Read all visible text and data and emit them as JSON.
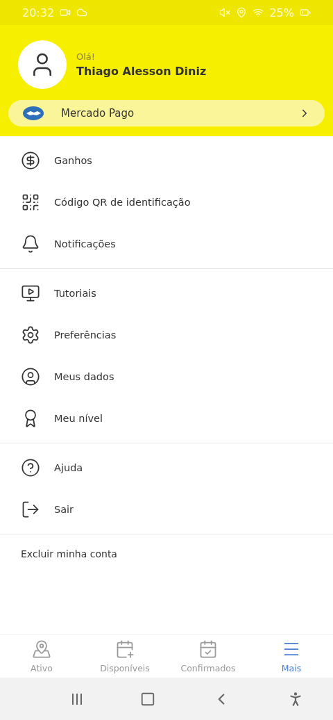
{
  "status_bar": {
    "time": "20:32",
    "battery": "25%"
  },
  "profile": {
    "greeting": "Olá!",
    "name": "Thiago Alesson Diniz"
  },
  "mercado_pago": {
    "label": "Mercado Pago"
  },
  "menu_groups": [
    [
      {
        "label": "Ganhos"
      },
      {
        "label": "Código QR de identificação"
      },
      {
        "label": "Notificações"
      }
    ],
    [
      {
        "label": "Tutoriais"
      },
      {
        "label": "Preferências"
      },
      {
        "label": "Meus dados"
      },
      {
        "label": "Meu nível"
      }
    ],
    [
      {
        "label": "Ajuda"
      },
      {
        "label": "Sair"
      }
    ]
  ],
  "delete_account": "Excluir minha conta",
  "bottom_nav": [
    {
      "label": "Ativo",
      "selected": false
    },
    {
      "label": "Disponíveis",
      "selected": false
    },
    {
      "label": "Confirmados",
      "selected": false
    },
    {
      "label": "Mais",
      "selected": true
    }
  ]
}
